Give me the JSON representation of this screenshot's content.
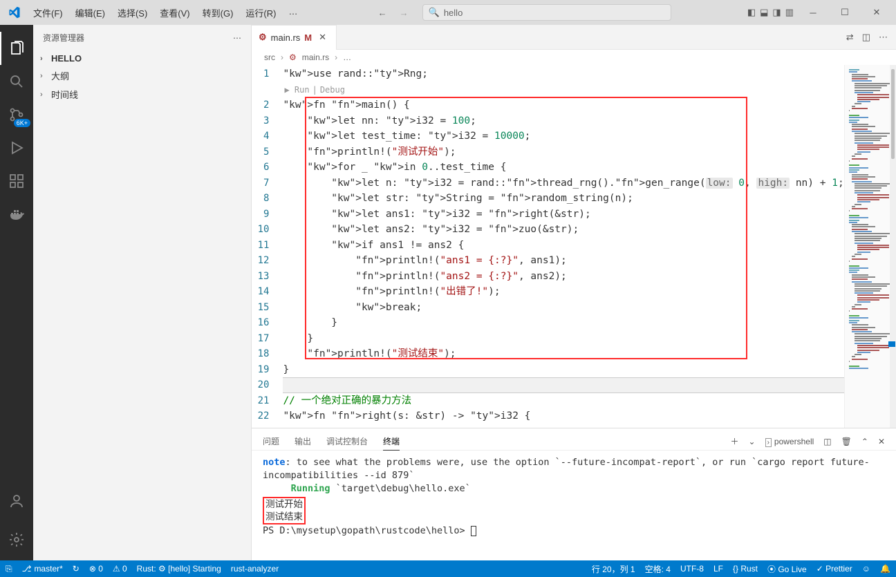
{
  "menu": {
    "file": "文件(F)",
    "edit": "编辑(E)",
    "select": "选择(S)",
    "view": "查看(V)",
    "goto": "转到(G)",
    "run": "运行(R)",
    "more": "…"
  },
  "search": {
    "placeholder": "hello"
  },
  "sidebar": {
    "title": "资源管理器",
    "sections": {
      "hello": "HELLO",
      "outline": "大纲",
      "timeline": "时间线"
    }
  },
  "activity_badge": "6K+",
  "tab": {
    "icon": "⚙",
    "filename": "main.rs",
    "modified": "M"
  },
  "tabs_right_icons": [
    "compare-icon",
    "split-icon",
    "more-icon"
  ],
  "breadcrumb": {
    "src": "src",
    "file": "main.rs",
    "more": "…"
  },
  "codelens": {
    "run": "Run",
    "debug": "Debug"
  },
  "code_lines": [
    "use rand::Rng;",
    "fn main() {",
    "    let nn: i32 = 100;",
    "    let test_time: i32 = 10000;",
    "    println!(\"测试开始\");",
    "    for _ in 0..test_time {",
    "        let n: i32 = rand::thread_rng().gen_range(low: 0, high: nn) + 1;",
    "        let str: String = random_string(n);",
    "        let ans1: i32 = right(&str);",
    "        let ans2: i32 = zuo(&str);",
    "        if ans1 != ans2 {",
    "            println!(\"ans1 = {:?}\", ans1);",
    "            println!(\"ans2 = {:?}\", ans2);",
    "            println!(\"出错了!\");",
    "            break;",
    "        }",
    "    }",
    "    println!(\"测试结束\");",
    "}",
    "",
    "// 一个绝对正确的暴力方法",
    "fn right(s: &str) -> i32 {"
  ],
  "line_numbers": [
    1,
    2,
    3,
    4,
    5,
    6,
    7,
    8,
    9,
    10,
    11,
    12,
    13,
    14,
    15,
    16,
    17,
    18,
    19,
    20,
    21,
    22
  ],
  "panel": {
    "tabs": {
      "problems": "问题",
      "output": "输出",
      "debug_console": "调试控制台",
      "terminal": "终端"
    },
    "shell": "powershell"
  },
  "terminal": {
    "note_label": "note",
    "note_text": ": to see what the problems were, use the option `--future-incompat-report`, or run `cargo report future-incompatibilities --id 879`",
    "running_label": "Running",
    "running_path": " `target\\debug\\hello.exe`",
    "out1": "测试开始",
    "out2": "测试结束",
    "prompt": "PS D:\\mysetup\\gopath\\rustcode\\hello> "
  },
  "status": {
    "branch": "master*",
    "sync": "↻",
    "errors": "⊗ 0",
    "warnings": "⚠ 0",
    "rust_status": "Rust: ⚙ [hello] Starting",
    "analyzer": "rust-analyzer",
    "pos": "行 20，列 1",
    "spaces": "空格: 4",
    "encoding": "UTF-8",
    "eol": "LF",
    "lang": "{} Rust",
    "golive": "⦿ Go Live",
    "prettier": "✓ Prettier",
    "feedback": "☺",
    "bell": "🔔"
  }
}
